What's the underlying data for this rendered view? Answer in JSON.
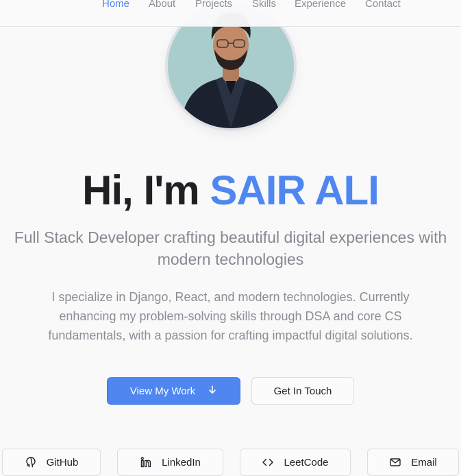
{
  "nav": {
    "items": [
      {
        "label": "Home",
        "active": true
      },
      {
        "label": "About"
      },
      {
        "label": "Projects"
      },
      {
        "label": "Skills"
      },
      {
        "label": "Experience"
      },
      {
        "label": "Contact"
      }
    ]
  },
  "hero": {
    "greeting": "Hi, I'm",
    "name": "SAIR ALI",
    "tagline": "Full Stack Developer crafting beautiful digital experiences with modern technologies",
    "about": "I specialize in Django, React, and modern technologies. Currently enhancing my problem-solving skills through DSA and core CS fundamentals, with a passion for crafting impactful digital solutions.",
    "primary_button": "View My Work",
    "secondary_button": "Get In Touch"
  },
  "social": [
    {
      "label": "GitHub",
      "icon": "github-icon"
    },
    {
      "label": "LinkedIn",
      "icon": "linkedin-icon"
    },
    {
      "label": "LeetCode",
      "icon": "code-icon"
    },
    {
      "label": "Email",
      "icon": "mail-icon"
    }
  ],
  "colors": {
    "accent": "#4f86f0",
    "background": "#f9f9fa",
    "muted_text": "#868991"
  }
}
